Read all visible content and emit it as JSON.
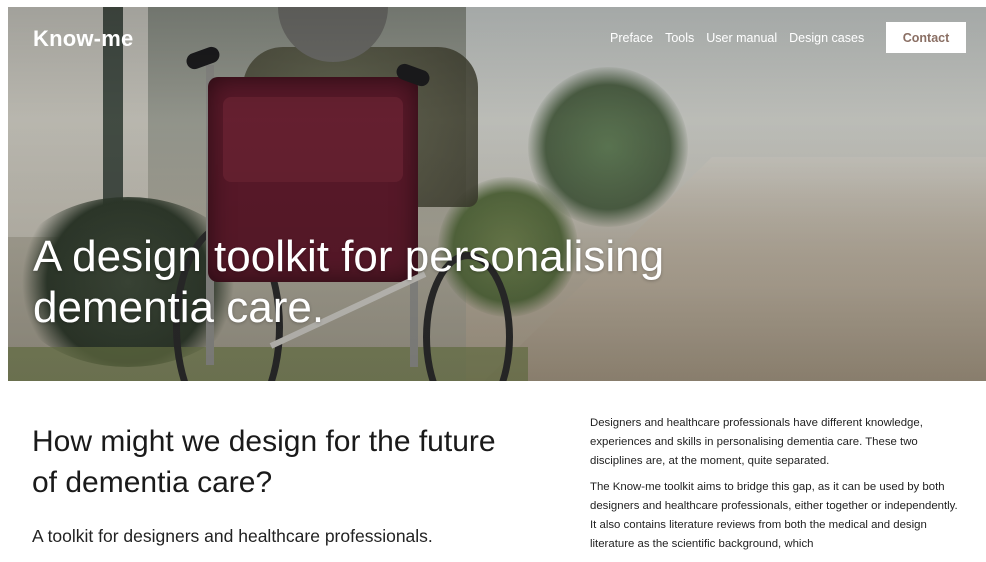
{
  "header": {
    "logo": "Know-me",
    "nav": [
      "Preface",
      "Tools",
      "User manual",
      "Design cases"
    ],
    "contact_label": "Contact"
  },
  "hero": {
    "title": "A design toolkit for personalising dementia care."
  },
  "intro": {
    "heading": "How might we design for the future of dementia care?",
    "subheading": "A toolkit for designers and healthcare professionals.",
    "paragraphs": [
      "Designers and healthcare professionals have different knowledge, experiences and skills in personalising dementia care. These two disciplines are, at the moment, quite separated.",
      "The Know-me toolkit aims to bridge this gap, as it can be used by both designers and healthcare professionals, either together or independently. It also contains literature reviews from both the medical and design literature as the scientific background, which"
    ]
  }
}
